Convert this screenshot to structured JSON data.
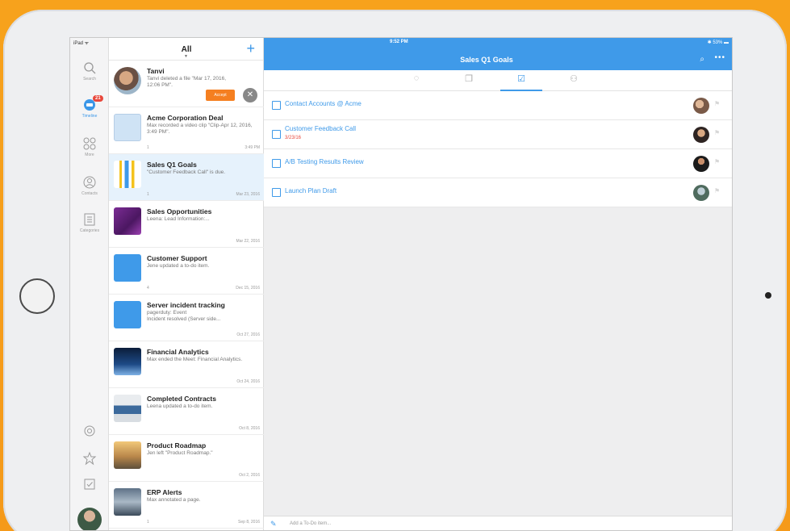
{
  "status": {
    "left": "iPad ᯤ",
    "time": "9:52 PM",
    "right": "✱ 53% ▬"
  },
  "rail": {
    "items": [
      {
        "label": "Search"
      },
      {
        "label": "Timeline",
        "badge": "21"
      },
      {
        "label": "More"
      },
      {
        "label": "Contacts"
      },
      {
        "label": "Categories"
      }
    ]
  },
  "list": {
    "title": "All",
    "caret": "▼",
    "plus": "+",
    "accept_label": "Accept",
    "close_label": "✕",
    "items": [
      {
        "title": "Tanvi",
        "text": "Tanvi deleted a file \"Mar 17, 2016, 12:06 PM\".",
        "meta": "",
        "date": ""
      },
      {
        "title": "Acme Corporation Deal",
        "text": "Max recorded a video clip \"Clip-Apr 12, 2016, 3:49 PM\".",
        "meta": "1",
        "date": "3:49 PM"
      },
      {
        "title": "Sales Q1 Goals",
        "text": "\"Customer Feedback Call\" is due.",
        "meta": "1",
        "date": "Mar 23, 2016"
      },
      {
        "title": "Sales Opportunities",
        "text": "Leena: Lead Information:...",
        "meta": "",
        "date": "Mar 22, 2016"
      },
      {
        "title": "Customer Support",
        "text": "Jene updated a to-do item.",
        "meta": "4",
        "date": "Dec 15, 2016"
      },
      {
        "title": "Server incident tracking",
        "text": "pagerduty: Event\nIncident resolved (Server side...",
        "meta": "",
        "date": "Oct 27, 2016"
      },
      {
        "title": "Financial Analytics",
        "text": "Max ended the Meet: Financial Analytics.",
        "meta": "",
        "date": "Oct 24, 2016"
      },
      {
        "title": "Completed Contracts",
        "text": "Leena updated a to-do item.",
        "meta": "",
        "date": "Oct 8, 2016"
      },
      {
        "title": "Product Roadmap",
        "text": "Jen left \"Product Roadmap.\"",
        "meta": "",
        "date": "Oct 2, 2016"
      },
      {
        "title": "ERP Alerts",
        "text": "Max annotated a page.",
        "meta": "1",
        "date": "Sep 8, 2016"
      }
    ]
  },
  "detail": {
    "title": "Sales Q1 Goals",
    "search_icon": "⌕",
    "more_icon": "•••",
    "tabs": [
      {
        "icon": "◌"
      },
      {
        "icon": "❐"
      },
      {
        "icon": "☑"
      },
      {
        "icon": "⚇"
      }
    ],
    "tasks": [
      {
        "label": "Contact Accounts @ Acme",
        "due": ""
      },
      {
        "label": "Customer Feedback Call",
        "due": "3/23/16"
      },
      {
        "label": "A/B Testing Results Review",
        "due": ""
      },
      {
        "label": "Launch Plan Draft",
        "due": ""
      }
    ],
    "flag_icon": "⚑",
    "add_icon": "✎",
    "add_placeholder": "Add a To-Do item..."
  },
  "colors": {
    "accent": "#3f9ae9",
    "orange": "#f57f20",
    "badge": "#e8473b"
  }
}
